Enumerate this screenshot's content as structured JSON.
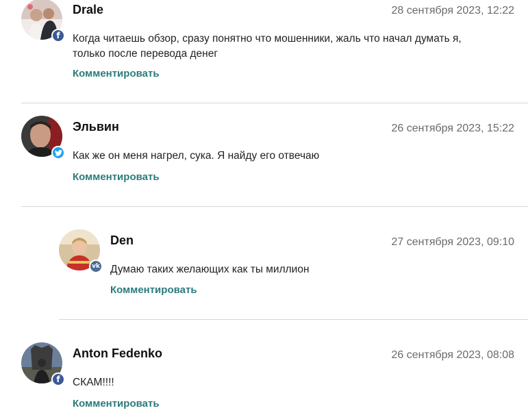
{
  "comments": [
    {
      "author": "Drale",
      "date": "28 сентября 2023, 12:22",
      "text_line1": "Когда читаешь обзор, сразу понятно что мошенники, жаль что начал думать я,",
      "text_line2": "только после перевода денег",
      "reply_label": "Комментировать",
      "social": "facebook",
      "social_color": "#3b5998"
    },
    {
      "author": "Эльвин",
      "date": "26 сентября 2023, 15:22",
      "text_line1": "Как же он меня нагрел, сука. Я найду его отвечаю",
      "reply_label": "Комментировать",
      "social": "twitter",
      "social_color": "#1da1f2"
    },
    {
      "author": "Den",
      "date": "27 сентября 2023, 09:10",
      "text_line1": "Думаю таких желающих как ты миллион",
      "reply_label": "Комментировать",
      "social": "vk",
      "social_color": "#4c6c91",
      "nested": true
    },
    {
      "author": "Anton Fedenko",
      "date": "26 сентября 2023, 08:08",
      "text_line1": "СКАМ!!!!",
      "reply_label": "Комментировать",
      "social": "facebook",
      "social_color": "#3b5998"
    }
  ],
  "colors": {
    "link": "#2a7c7a",
    "date": "#6a6a6a",
    "divider": "#d6d6d6"
  }
}
